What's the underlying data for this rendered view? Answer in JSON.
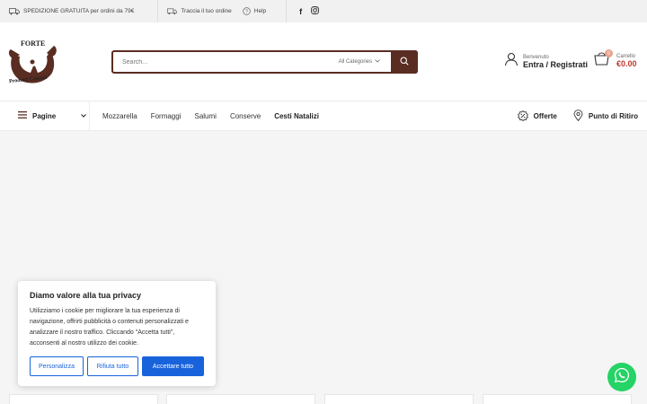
{
  "topbar": {
    "shipping": "SPEDIZIONE GRATUITA per ordini da 79€",
    "track": "Traccia il tuo ordine",
    "help": "Help",
    "facebook": "f"
  },
  "header": {
    "logo_text_top": "FORTE",
    "logo_text_bottom": "Prodotti Caseari",
    "search_placeholder": "Search...",
    "category": "All Categories",
    "account_small": "Benvenuto",
    "account_big": "Entra / Registrati",
    "cart_small": "Carrello",
    "cart_price": "€0.00",
    "cart_count": "0"
  },
  "nav": {
    "pages": "Pagine",
    "menu": [
      "Mozzarella",
      "Formaggi",
      "Salumi",
      "Conserve",
      "Cesti Natalizi"
    ],
    "offers": "Offerte",
    "pickup": "Punto di Ritiro"
  },
  "cookie": {
    "title": "Diamo valore alla tua privacy",
    "text": "Utilizziamo i cookie per migliorare la tua esperienza di navigazione, offrirti pubblicità o contenuti personalizzati e analizzare il nostro traffico. Cliccando \"Accetta tutti\", acconsenti al nostro utilizzo dei cookie.",
    "customize": "Personalizza",
    "reject": "Rifiuta tutto",
    "accept": "Accettare tutto"
  },
  "colors": {
    "brand": "#5a2d22",
    "accent": "#1863dc",
    "whatsapp": "#25d366",
    "price": "#c0392b"
  }
}
